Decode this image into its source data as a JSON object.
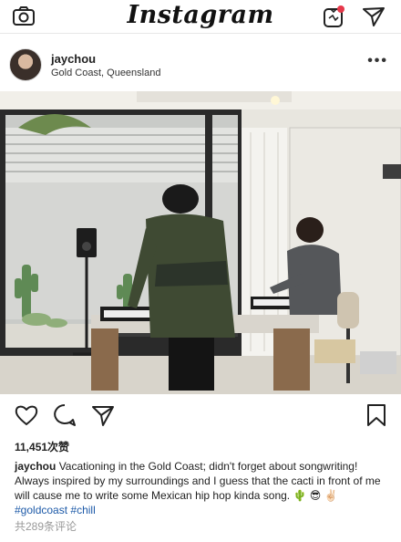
{
  "topbar": {
    "logo": "Instagram",
    "icons": [
      "camera-icon",
      "igtv-icon",
      "direct-message-icon"
    ]
  },
  "post": {
    "username": "jaychou",
    "location": "Gold Coast, Queensland",
    "more": "•••",
    "image_description_icon": "photo-icon",
    "likes": "11,451次赞",
    "caption_user": "jaychou",
    "caption_text": " Vacationing in the Gold Coast; didn't forget about songwriting! Always inspired by my surroundings and I guess that the cacti in front of me will cause me to write some Mexican hip hop kinda song.",
    "caption_emoji": "🌵 😎 ✌🏻",
    "hashtag1": "#goldcoast",
    "hashtag2": "#chill",
    "comments": "共289条评论"
  },
  "actions": {
    "icons": [
      "heart-icon",
      "comment-icon",
      "share-icon",
      "bookmark-icon"
    ]
  }
}
